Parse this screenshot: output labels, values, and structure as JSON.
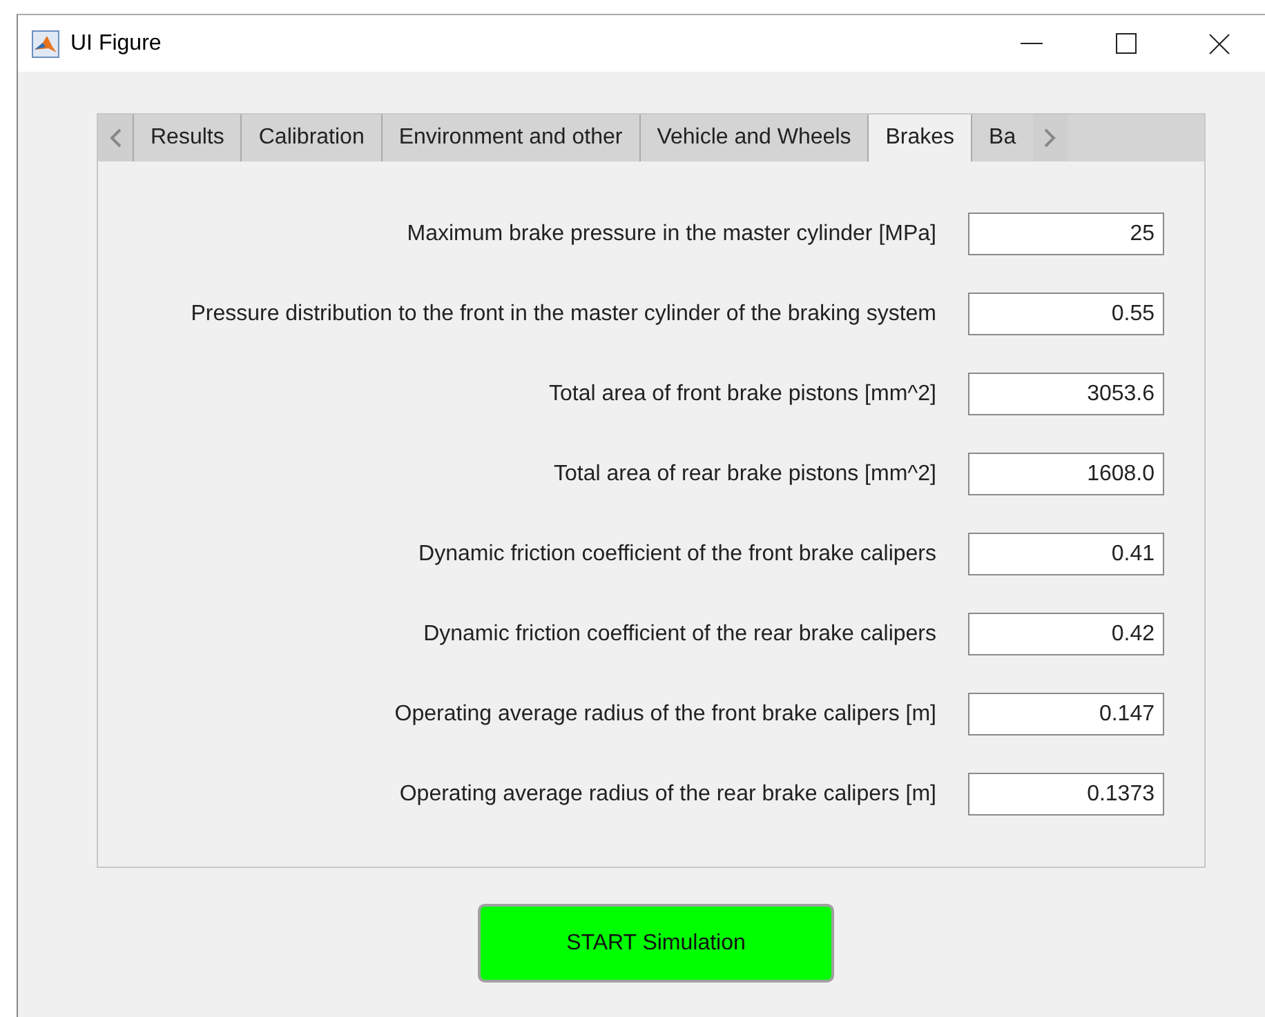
{
  "window": {
    "title": "UI Figure"
  },
  "tabs": [
    {
      "label": "Results",
      "selected": false
    },
    {
      "label": "Calibration",
      "selected": false
    },
    {
      "label": "Environment and other",
      "selected": false
    },
    {
      "label": "Vehicle and Wheels",
      "selected": false
    },
    {
      "label": "Brakes",
      "selected": true
    },
    {
      "label": "Ba",
      "selected": false
    }
  ],
  "fields": [
    {
      "label": "Maximum brake pressure in the master cylinder [MPa]",
      "value": "25"
    },
    {
      "label": "Pressure distribution to the front in the master cylinder of the braking system",
      "value": "0.55"
    },
    {
      "label": "Total area of front brake pistons [mm^2]",
      "value": "3053.6"
    },
    {
      "label": "Total area of rear brake pistons [mm^2]",
      "value": "1608.0"
    },
    {
      "label": "Dynamic friction coefficient of the front brake calipers",
      "value": "0.41"
    },
    {
      "label": "Dynamic friction coefficient of the rear brake calipers",
      "value": "0.42"
    },
    {
      "label": "Operating average radius of the front brake calipers [m]",
      "value": "0.147"
    },
    {
      "label": "Operating average radius of the rear brake calipers [m]",
      "value": "0.1373"
    }
  ],
  "button": {
    "label": "START Simulation"
  }
}
